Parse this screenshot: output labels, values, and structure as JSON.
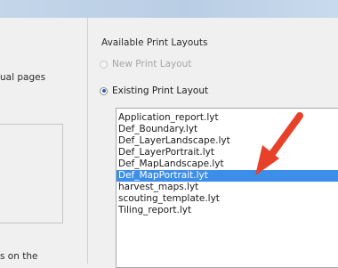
{
  "left": {
    "fragment_top": "ual pages",
    "fragment_bottom": "s on the"
  },
  "layouts": {
    "group_label": "Available Print Layouts",
    "new_option": "New Print Layout",
    "existing_option": "Existing Print Layout",
    "selected_index": 5,
    "items": [
      "Application_report.lyt",
      "Def_Boundary.lyt",
      "Def_LayerLandscape.lyt",
      "Def_LayerPortrait.lyt",
      "Def_MapLandscape.lyt",
      "Def_MapPortrait.lyt",
      "harvest_maps.lyt",
      "scouting_template.lyt",
      "Tiling_report.lyt"
    ]
  },
  "annotation": {
    "arrow_color": "#e8412a",
    "arrow_icon": "red-arrow-icon"
  }
}
